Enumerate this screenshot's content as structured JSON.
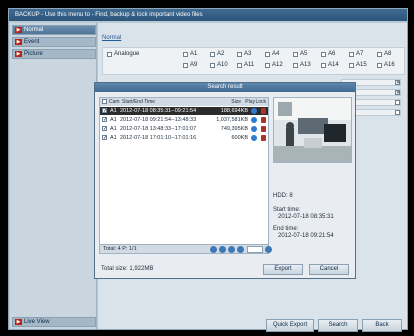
{
  "window": {
    "title": "BACKUP - Use this menu to - Find, backup & lock important video files"
  },
  "sidebar": {
    "items": [
      {
        "label": "Normal"
      },
      {
        "label": "Event"
      },
      {
        "label": "Picture"
      }
    ],
    "live_view": "Live View"
  },
  "main": {
    "tab": "Normal",
    "analogue_label": "Analogue",
    "channels": [
      "A1",
      "A2",
      "A3",
      "A4",
      "A5",
      "A6",
      "A7",
      "A8",
      "A9",
      "A10",
      "A11",
      "A12",
      "A13",
      "A14",
      "A15",
      "A16"
    ]
  },
  "dialog": {
    "title": "Search result",
    "headers": {
      "cam": "Cam",
      "time": "Start/End Time",
      "size": "Size",
      "play": "Play",
      "lock": "Lock"
    },
    "rows": [
      {
        "cam": "A1",
        "time": "2012-07-18 08:35:31--09:21:54",
        "size": "188,694KB",
        "checked": "✓"
      },
      {
        "cam": "A1",
        "time": "2012-07-18 09:21:54--13:48:33",
        "size": "1,037,581KB",
        "checked": "✓"
      },
      {
        "cam": "A1",
        "time": "2012-07-18 13:48:33--17:01:07",
        "size": "749,395KB",
        "checked": "✓"
      },
      {
        "cam": "A1",
        "time": "2012-07-18 17:01:10--17:01:16",
        "size": "600KB",
        "checked": "✓"
      }
    ],
    "total_pages": "Total: 4  P: 1/1",
    "total_size": "Total size: 1,922MB",
    "hdd": "HDD: 8",
    "start_label": "Start time:",
    "start_value": "2012-07-18 08:35:31",
    "end_label": "End time:",
    "end_value": "2012-07-18 09:21:54",
    "export": "Export",
    "cancel": "Cancel"
  },
  "bottom": {
    "quick_export": "Quick Export",
    "search": "Search",
    "back": "Back"
  },
  "icons": {
    "arrow": "arrow-right-icon",
    "play": "play-icon",
    "lock": "lock-icon"
  },
  "colors": {
    "accent": "#2b5478",
    "selected_row": "#2c2c2c",
    "arrow": "#b2261b"
  }
}
